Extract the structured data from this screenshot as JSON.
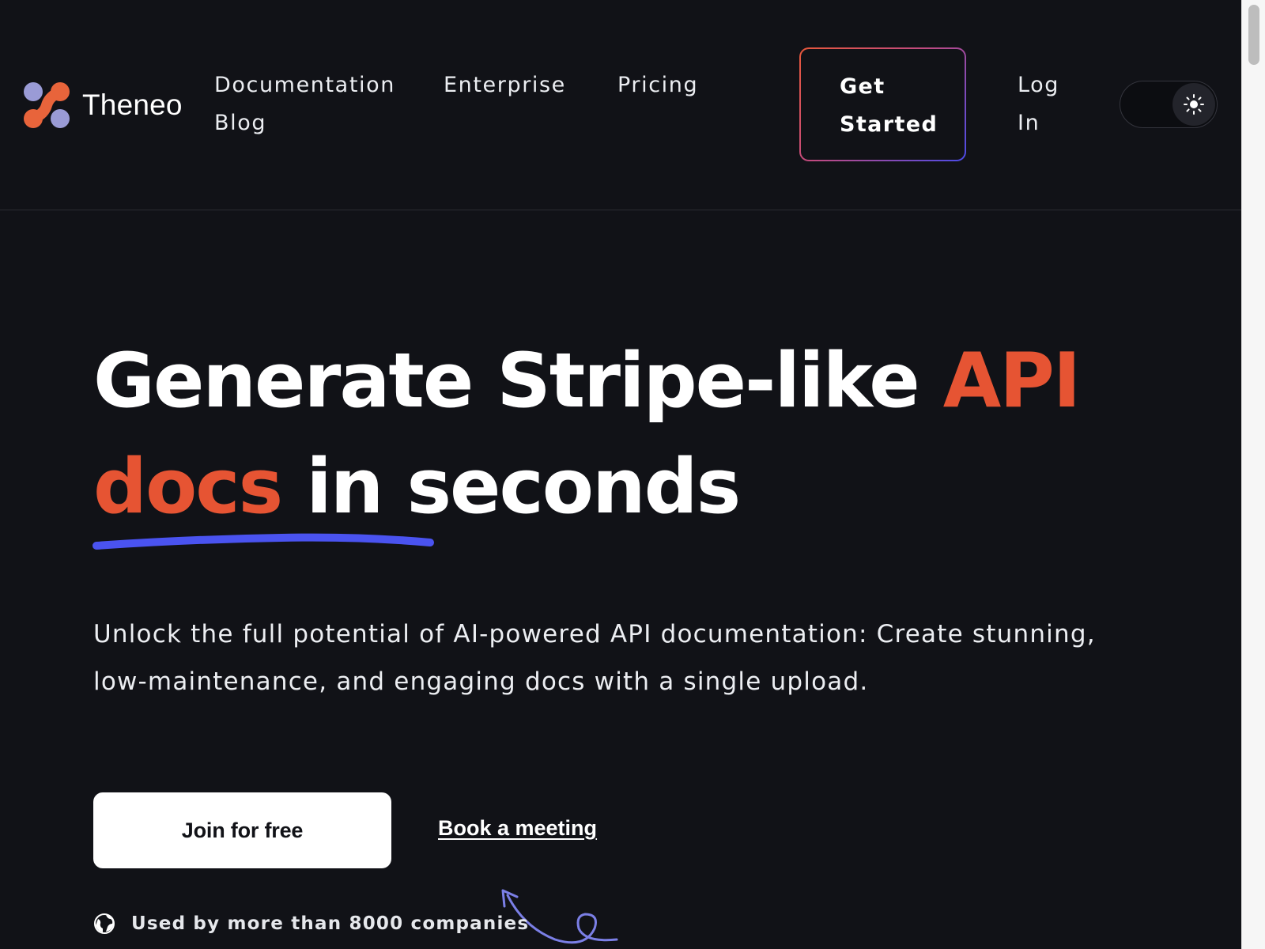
{
  "brand": {
    "name": "Theneo"
  },
  "nav": {
    "documentation": "Documentation",
    "blog": "Blog",
    "enterprise": "Enterprise",
    "pricing": "Pricing",
    "get_started": "Get Started",
    "login": "Log In"
  },
  "theme_toggle": {
    "icon": "sun-icon",
    "state": "light"
  },
  "hero": {
    "title_part1": "Generate Stripe-like ",
    "title_accent1": "API",
    "title_accent2": "docs",
    "title_part2": " in seconds",
    "subtitle": "Unlock the full potential of AI-powered API documentation: Create stunning, low-maintenance, and engaging docs with a single upload."
  },
  "cta": {
    "join": "Join for free",
    "book": "Book a meeting"
  },
  "social_proof": {
    "icon": "globe-icon",
    "text": "Used by more than 8000 companies"
  },
  "colors": {
    "background": "#111217",
    "accent_orange": "#e65433",
    "accent_blue": "#4a53f0",
    "logo_lavender": "#9a9bd6"
  }
}
